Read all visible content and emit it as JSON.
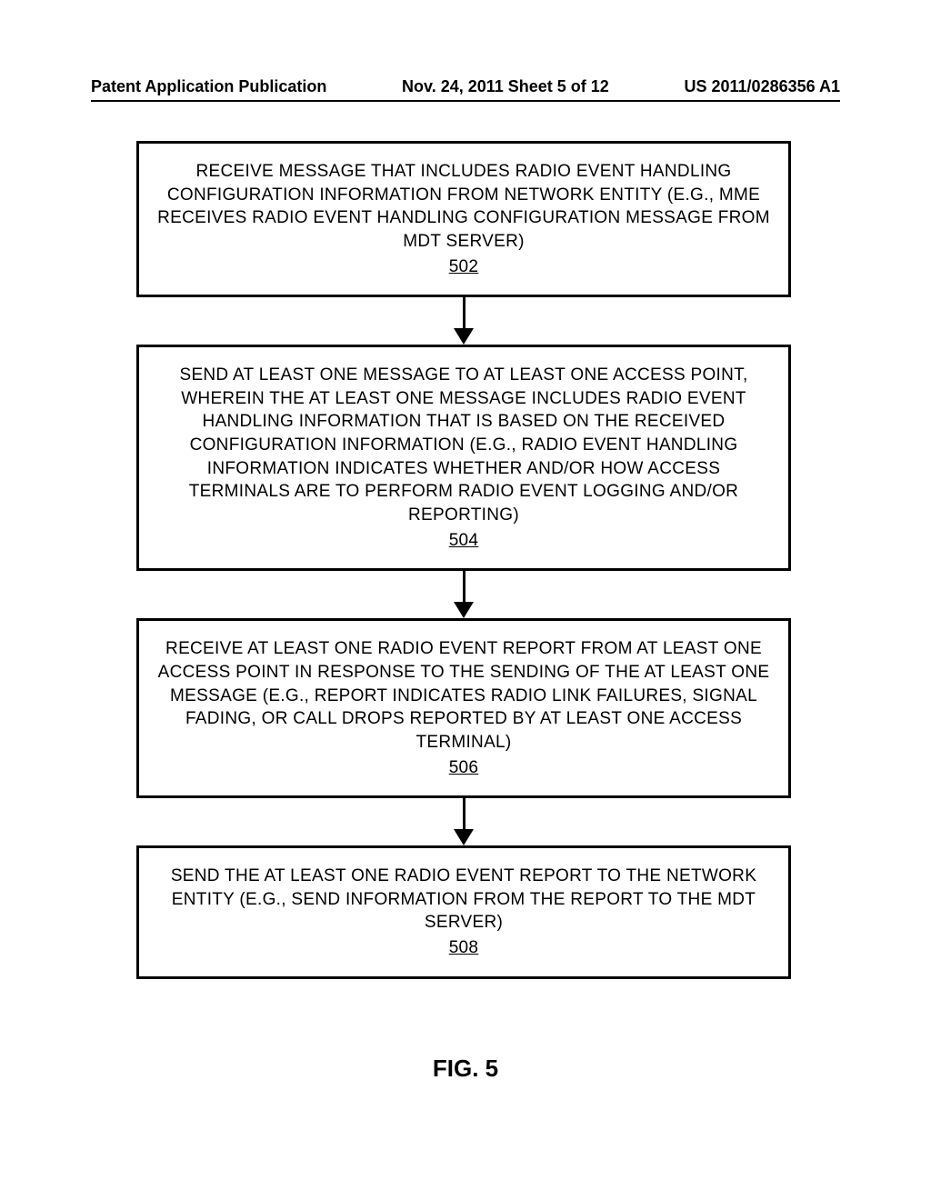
{
  "header": {
    "left": "Patent Application Publication",
    "center": "Nov. 24, 2011  Sheet 5 of 12",
    "right": "US 2011/0286356 A1"
  },
  "boxes": {
    "b502": {
      "text": "RECEIVE MESSAGE THAT INCLUDES RADIO EVENT HANDLING CONFIGURATION INFORMATION FROM NETWORK ENTITY (E.G., MME RECEIVES RADIO EVENT HANDLING CONFIGURATION MESSAGE FROM MDT SERVER)",
      "num": "502"
    },
    "b504": {
      "text": "SEND AT LEAST ONE MESSAGE TO AT LEAST ONE ACCESS POINT, WHEREIN THE AT LEAST ONE MESSAGE INCLUDES RADIO EVENT HANDLING INFORMATION THAT IS BASED ON THE RECEIVED CONFIGURATION INFORMATION (E.G., RADIO EVENT HANDLING INFORMATION INDICATES WHETHER AND/OR HOW ACCESS TERMINALS ARE TO PERFORM RADIO EVENT LOGGING AND/OR REPORTING)",
      "num": "504"
    },
    "b506": {
      "text": "RECEIVE AT LEAST ONE RADIO EVENT REPORT FROM AT LEAST ONE ACCESS POINT IN RESPONSE TO THE SENDING OF THE AT LEAST ONE MESSAGE (E.G., REPORT INDICATES RADIO LINK FAILURES, SIGNAL FADING, OR CALL DROPS REPORTED BY AT LEAST ONE ACCESS TERMINAL)",
      "num": "506"
    },
    "b508": {
      "text": "SEND THE AT LEAST ONE RADIO EVENT REPORT TO THE NETWORK ENTITY (E.G., SEND INFORMATION FROM THE REPORT TO THE MDT SERVER)",
      "num": "508"
    }
  },
  "figure_label": "FIG. 5"
}
